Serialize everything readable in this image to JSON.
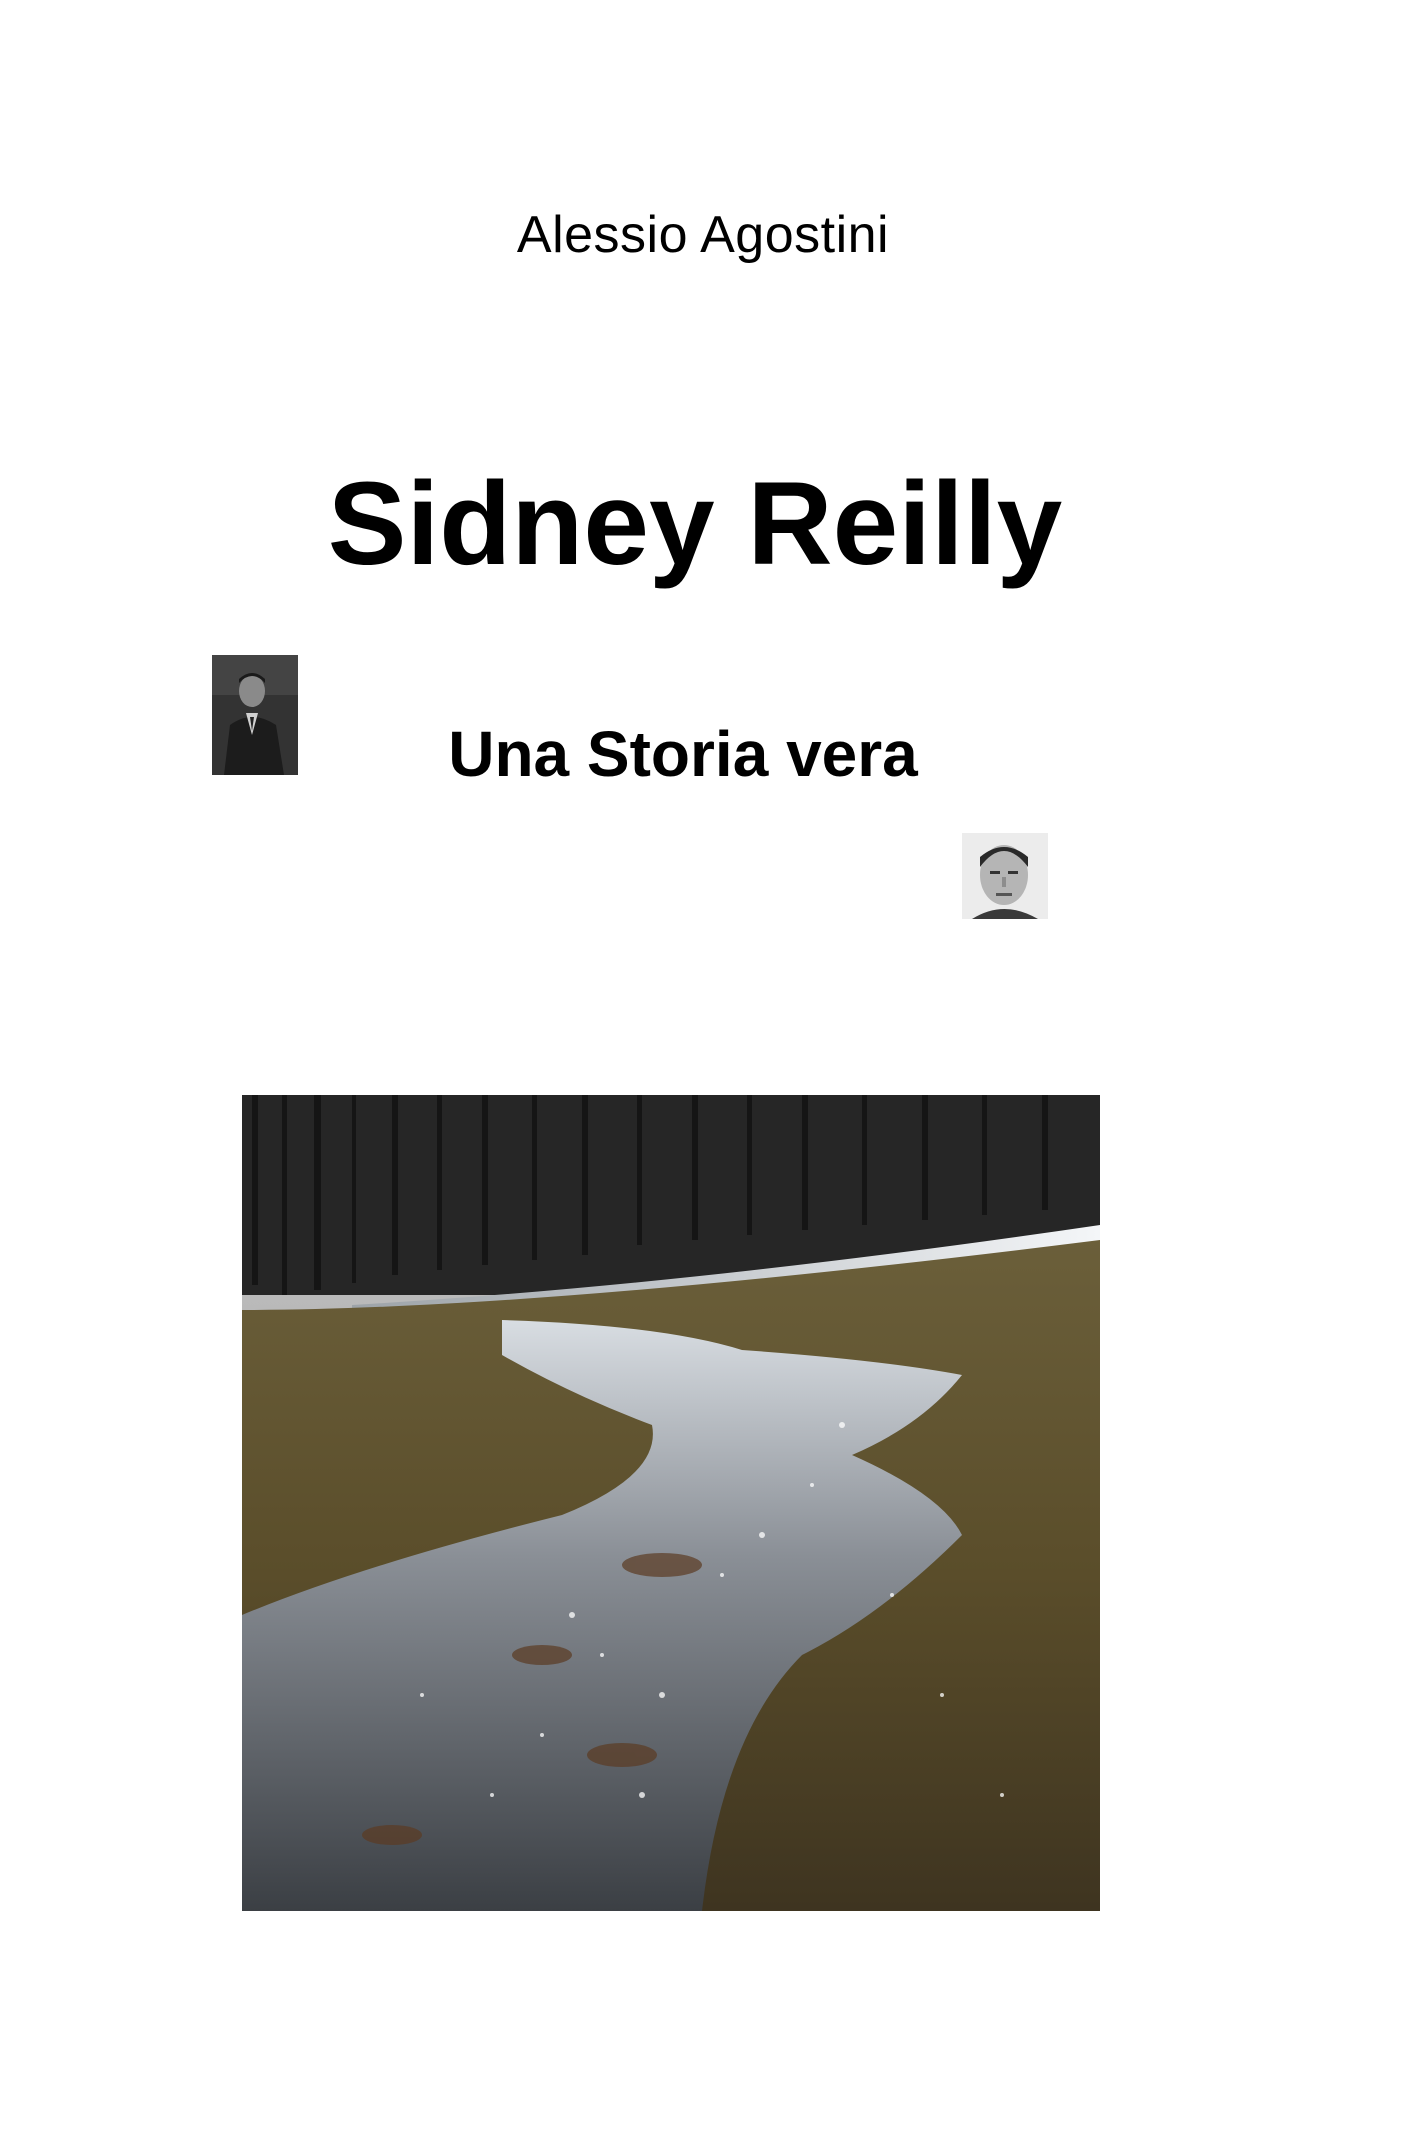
{
  "cover": {
    "author": "Alessio Agostini",
    "title": "Sidney Reilly",
    "subtitle": "Una Storia vera"
  }
}
